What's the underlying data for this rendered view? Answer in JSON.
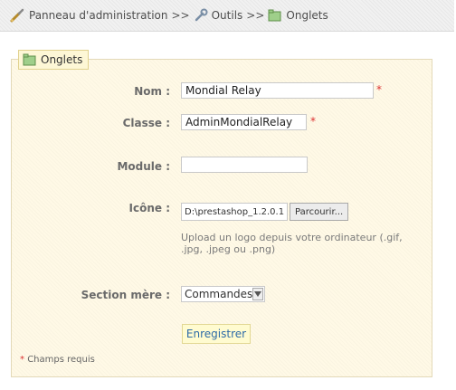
{
  "breadcrumb": {
    "items": [
      "Panneau d'administration",
      "Outils",
      "Onglets"
    ],
    "separator": ">>"
  },
  "legend": {
    "label": "Onglets"
  },
  "form": {
    "nom": {
      "label": "Nom :",
      "value": "Mondial Relay",
      "required": "*"
    },
    "classe": {
      "label": "Classe :",
      "value": "AdminMondialRelay",
      "required": "*"
    },
    "module": {
      "label": "Module :",
      "value": ""
    },
    "icone": {
      "label": "Icône :",
      "path": "D:\\prestashop_1.2.0.1",
      "button_label": "Parcourir...",
      "help": "Upload un logo depuis votre ordinateur (.gif, .jpg, .jpeg ou .png)"
    },
    "section_mere": {
      "label": "Section mère :",
      "selected": "Commandes"
    },
    "save_label": "Enregistrer"
  },
  "footnote": {
    "star": "*",
    "text": "Champs requis"
  },
  "colors": {
    "panel_bg": "#fff9e6",
    "link_blue": "#2e6ba7",
    "required_red": "#dd3333"
  },
  "icons": {
    "admin": "wrench-pencil-icon",
    "tools": "wrench-icon",
    "tabs": "tabs-icon"
  }
}
